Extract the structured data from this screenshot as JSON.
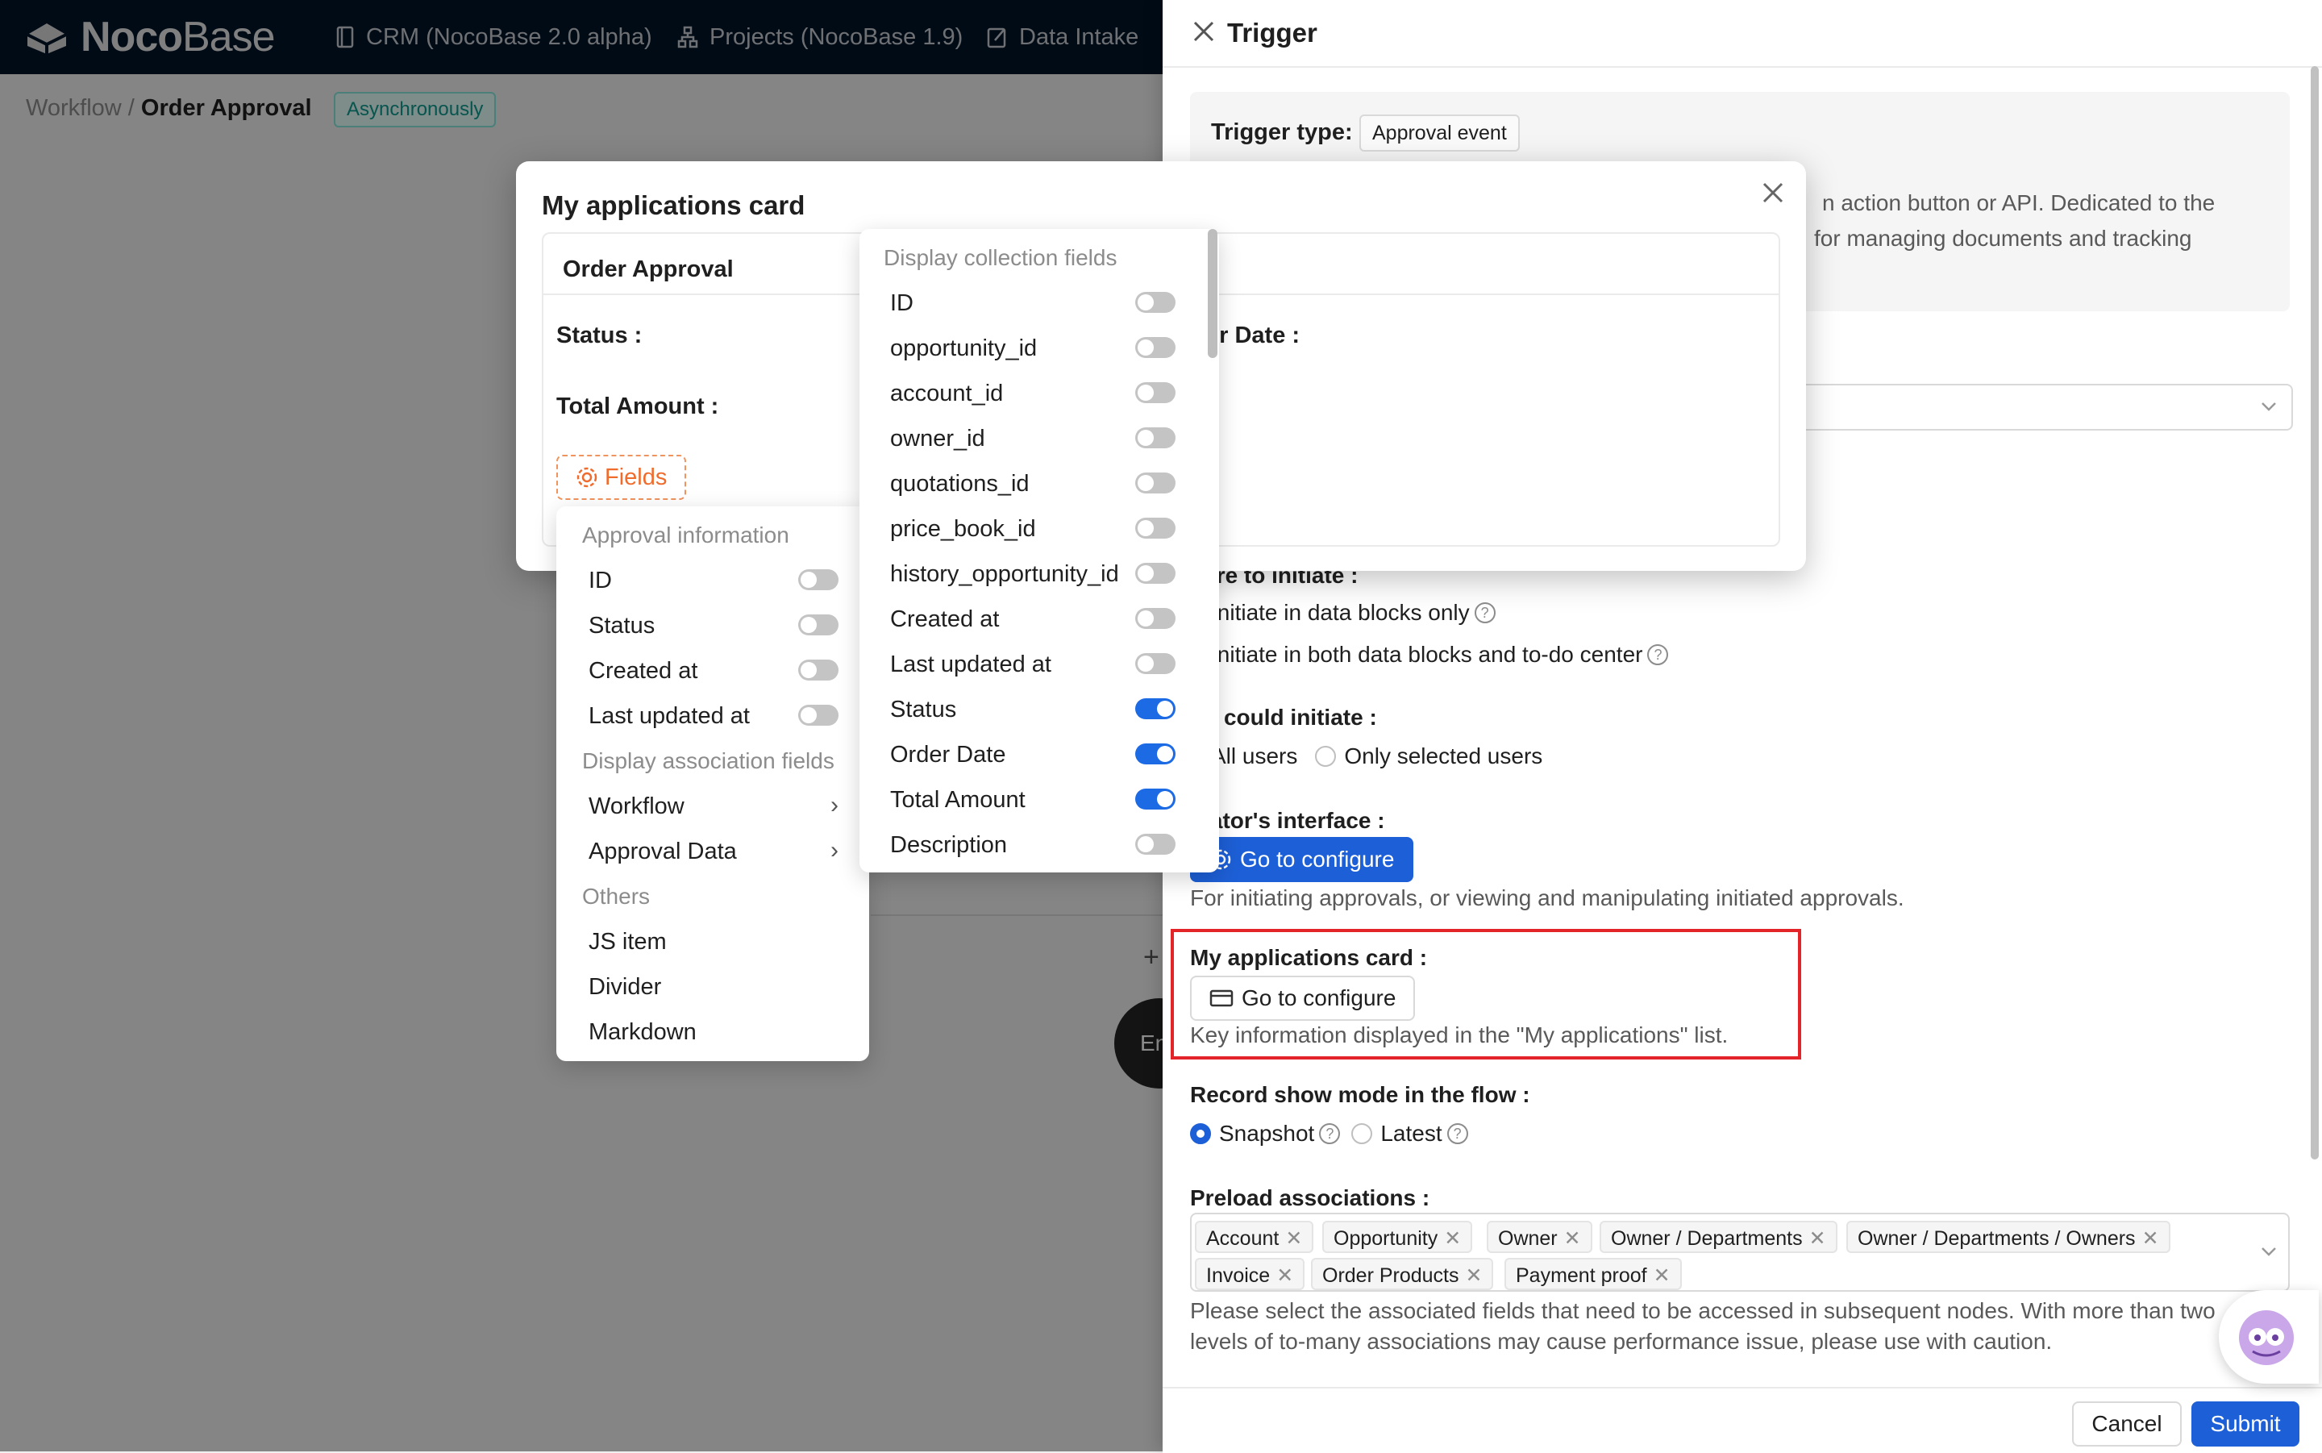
{
  "nav": {
    "logo_bold": "Noco",
    "logo_thin": "Base",
    "items": [
      "CRM (NocoBase 2.0 alpha)",
      "Projects (NocoBase 1.9)",
      "Data Intake"
    ]
  },
  "breadcrumb": {
    "parent": "Workflow",
    "separator": " / ",
    "current": "Order Approval"
  },
  "mode_tag": "Asynchronously",
  "canvas": {
    "end_node": "En"
  },
  "drawer": {
    "title": "Trigger",
    "trigger_type_label": "Trigger type:",
    "trigger_type_value": "Approval event",
    "description_lines": [
      "n action button or API. Dedicated to the",
      "for managing documents and tracking"
    ],
    "where_label": "here to initiate :",
    "where_options": [
      "Initiate in data blocks only",
      "Initiate in both data blocks and to-do center"
    ],
    "who_label": "ho could initiate :",
    "who_options": [
      "All users",
      "Only selected users"
    ],
    "interface_label": "itiator's interface :",
    "interface_button": "Go to configure",
    "interface_help": "For initiating approvals, or viewing and manipulating initiated approvals.",
    "card_label": "My applications card :",
    "card_button": "Go to configure",
    "card_help": "Key information displayed in the \"My applications\" list.",
    "record_label": "Record show mode in the flow :",
    "record_options": [
      "Snapshot",
      "Latest"
    ],
    "preload_label": "Preload associations :",
    "preload_chips": [
      "Account",
      "Opportunity",
      "Owner",
      "Owner / Departments",
      "Owner / Departments / Owners",
      "Invoice",
      "Order Products",
      "Payment proof"
    ],
    "preload_help_1": "Please select the associated fields that need to be accessed in subsequent nodes. With more than two",
    "preload_help_2": "levels of to-many associations may cause performance issue, please use with caution.",
    "cancel": "Cancel",
    "submit": "Submit"
  },
  "modal": {
    "title": "My applications card",
    "card_title": "Order Approval",
    "fields": [
      "Status :",
      "Total Amount :",
      "er Date :"
    ],
    "fields_button": "Fields"
  },
  "menu_left": {
    "group_approval": "Approval information",
    "approval_items": [
      {
        "label": "ID",
        "on": false
      },
      {
        "label": "Status",
        "on": false
      },
      {
        "label": "Created at",
        "on": false
      },
      {
        "label": "Last updated at",
        "on": false
      }
    ],
    "group_association": "Display association fields",
    "association_items": [
      "Workflow",
      "Approval Data"
    ],
    "group_others": "Others",
    "other_items": [
      "JS item",
      "Divider",
      "Markdown"
    ]
  },
  "menu_right": {
    "group": "Display collection fields",
    "items": [
      {
        "label": "ID",
        "on": false
      },
      {
        "label": "opportunity_id",
        "on": false
      },
      {
        "label": "account_id",
        "on": false
      },
      {
        "label": "owner_id",
        "on": false
      },
      {
        "label": "quotations_id",
        "on": false
      },
      {
        "label": "price_book_id",
        "on": false
      },
      {
        "label": "history_opportunity_id",
        "on": false
      },
      {
        "label": "Created at",
        "on": false
      },
      {
        "label": "Last updated at",
        "on": false
      },
      {
        "label": "Status",
        "on": true
      },
      {
        "label": "Order Date",
        "on": true
      },
      {
        "label": "Total Amount",
        "on": true
      },
      {
        "label": "Description",
        "on": false
      }
    ]
  },
  "colors": {
    "primary": "#1d5fd6",
    "switch_on": "#1d6ae5",
    "highlight": "#e3252a",
    "nav_bg": "#001529",
    "fields_button": "#ef6c2c"
  }
}
